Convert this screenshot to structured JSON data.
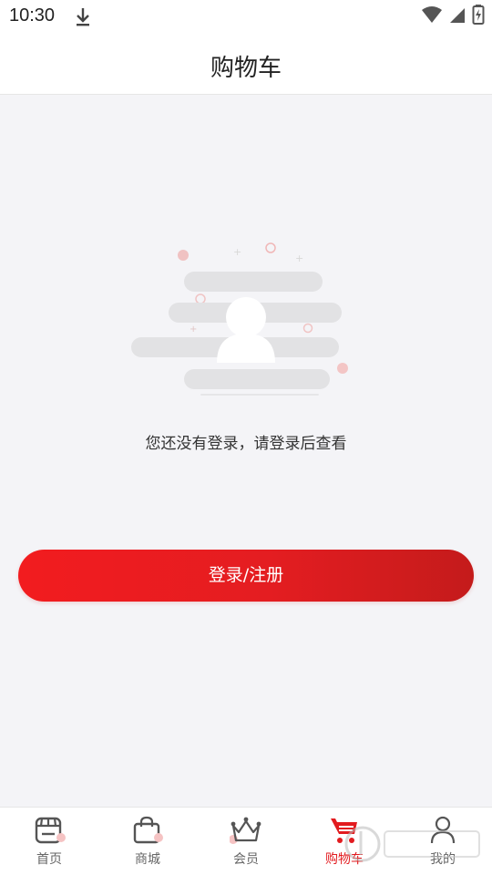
{
  "status_bar": {
    "time": "10:30"
  },
  "header": {
    "title": "购物车"
  },
  "empty_state": {
    "message": "您还没有登录，请登录后查看"
  },
  "actions": {
    "login_label": "登录/注册"
  },
  "tabbar": {
    "items": [
      {
        "label": "首页",
        "icon": "store-icon"
      },
      {
        "label": "商城",
        "icon": "shopping-bag-icon"
      },
      {
        "label": "会员",
        "icon": "crown-icon"
      },
      {
        "label": "购物车",
        "icon": "cart-icon",
        "active": true
      },
      {
        "label": "我的",
        "icon": "person-icon"
      }
    ]
  },
  "colors": {
    "accent": "#e21b1f",
    "background": "#f4f4f7",
    "text_primary": "#222222",
    "text_secondary": "#666666"
  }
}
